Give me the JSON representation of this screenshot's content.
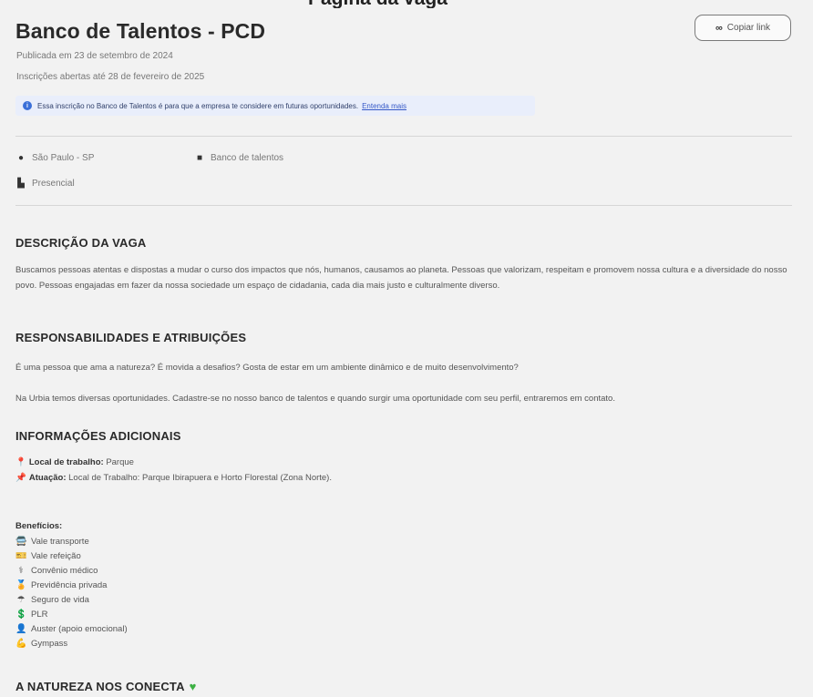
{
  "window_top_cut_text": "Página da vaga",
  "job": {
    "title": "Banco de Talentos - PCD",
    "published": "Publicada em 23 de setembro de 2024",
    "registration": "Inscrições abertas até 28 de fevereiro de 2025",
    "copy_link_label": "Copiar link"
  },
  "notice": {
    "text": "Essa inscrição no Banco de Talentos é para que a empresa te considere em futuras oportunidades.",
    "link_label": "Entenda mais"
  },
  "attributes": {
    "location": "São Paulo - SP",
    "type": "Banco de talentos",
    "mode": "Presencial"
  },
  "sections": {
    "description_title": "DESCRIÇÃO DA VAGA",
    "description_text": "Buscamos pessoas atentas e dispostas a mudar o curso dos impactos que nós, humanos, causamos ao planeta. Pessoas que valorizam, respeitam e promovem nossa cultura e a diversidade do nosso povo. Pessoas engajadas em fazer da nossa sociedade um espaço de cidadania, cada dia mais justo e culturalmente diverso.",
    "responsibilities_title": "RESPONSABILIDADES E ATRIBUIÇÕES",
    "responsibilities_p1": "É uma pessoa que ama a natureza? É movida a desafios? Gosta de estar em um ambiente dinâmico e de muito desenvolvimento?",
    "responsibilities_p2": "Na Urbia temos diversas oportunidades. Cadastre-se no nosso banco de talentos e quando surgir uma oportunidade com seu perfil, entraremos em contato.",
    "additional_title": "INFORMAÇÕES ADICIONAIS",
    "workplace_label": "Local de trabalho:",
    "workplace_value": "Parque",
    "acting_label": "Atuação:",
    "acting_value": "Local de Trabalho: Parque Ibirapuera e Horto Florestal (Zona Norte).",
    "benefits_title": "Benefícios:",
    "nature_title": "A NATUREZA NOS CONECTA"
  },
  "benefits": [
    {
      "icon": "bus-icon",
      "label": "Vale transporte"
    },
    {
      "icon": "ticket-icon",
      "label": "Vale refeição"
    },
    {
      "icon": "health-icon",
      "label": "Convênio médico"
    },
    {
      "icon": "medal-icon",
      "label": "Previdência privada"
    },
    {
      "icon": "umbrella-icon",
      "label": "Seguro de vida"
    },
    {
      "icon": "money-icon",
      "label": "PLR"
    },
    {
      "icon": "person-icon",
      "label": "Auster (apoio emocional)"
    },
    {
      "icon": "muscle-icon",
      "label": "Gympass"
    }
  ],
  "colors": {
    "background": "#f2f2f2",
    "notice_bg": "#e9eefb",
    "link": "#3558c7",
    "heart": "#3cb043"
  }
}
